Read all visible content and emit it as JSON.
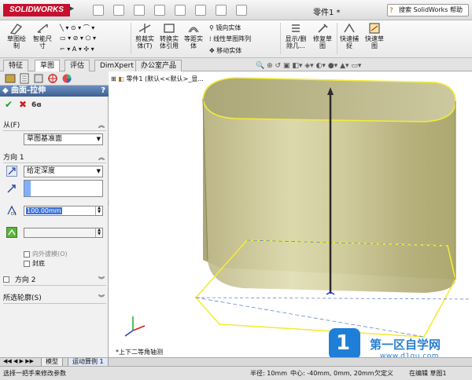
{
  "app": {
    "logo": "SOLIDWORKS",
    "doc_title": "零件1 *",
    "search_placeholder": "搜索 SolidWorks 帮助"
  },
  "ribbon": {
    "buttons": [
      {
        "label": "草图绘\n制"
      },
      {
        "label": "智能尺\n寸"
      },
      {
        "label": "剪裁实\n体(T)"
      },
      {
        "label": "转换实\n体引用"
      },
      {
        "label": "等距实\n体"
      },
      {
        "label": "显示/删\n除几..."
      },
      {
        "label": "修复草\n图"
      },
      {
        "label": "快速捕\n捉"
      },
      {
        "label": "快速草\n图"
      }
    ],
    "small_items": [
      "镜向实体",
      "线性草图阵列",
      "移动实体"
    ]
  },
  "tabs": [
    "特征",
    "草图",
    "评估",
    "DimXpert",
    "办公室产品"
  ],
  "active_tab": "草图",
  "panel": {
    "feature_title": "曲面-拉伸",
    "help": "?",
    "from_label": "从(F)",
    "from_value": "草图基准面",
    "dir1_label": "方向 1",
    "dir1_end": "给定深度",
    "depth_value": "100.00mm",
    "draft_label": "向外拔模(O)",
    "cap_label": "封底",
    "dir2_label": "方向 2",
    "contours_label": "所选轮廓(S)"
  },
  "viewport": {
    "tree_node": "零件1  (默认<<默认>_显...",
    "view_label": "*上下二等角轴测"
  },
  "bottom_tabs": [
    "模型",
    "运动算例 1"
  ],
  "status": {
    "left": "选择一把手来修改参数",
    "radius": "半径: 10mm",
    "center": "中心: -40mm, 0mm, 20mm",
    "state": "欠定义",
    "editing": "在编辑 草图1"
  },
  "watermark": {
    "text": "第一区自学网",
    "url": "www.d1qu.com"
  },
  "colors": {
    "accent": "#c8102e",
    "panel_header": "#3e5f94",
    "surface": "#d6d3a0"
  }
}
